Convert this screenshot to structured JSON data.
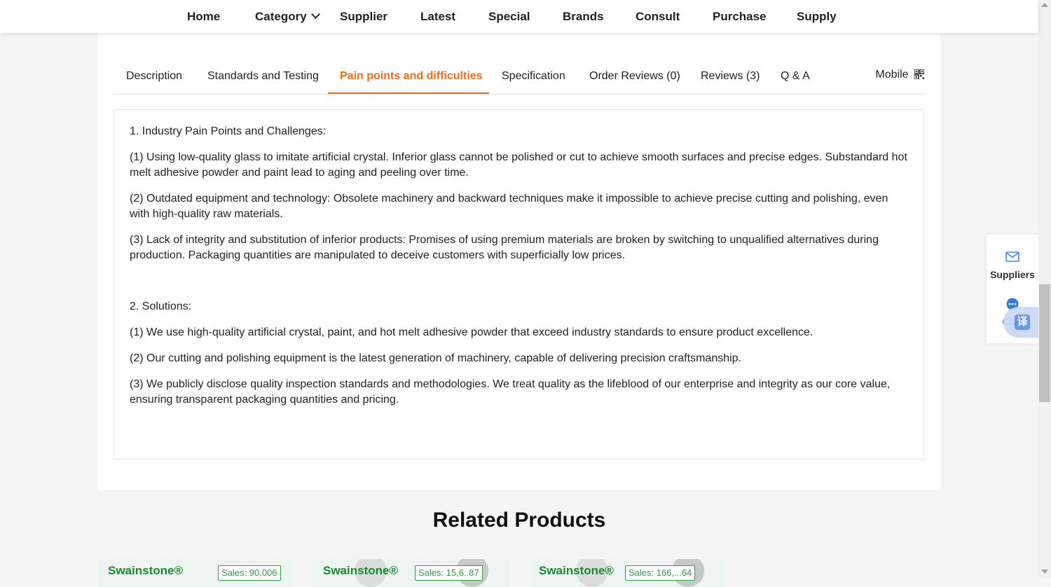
{
  "nav": {
    "home": "Home",
    "category": "Category",
    "supplier": "Supplier",
    "latest": "Latest",
    "special": "Special",
    "brands": "Brands",
    "consult": "Consult",
    "purchase": "Purchase",
    "supply": "Supply"
  },
  "tabs": {
    "description": "Description",
    "standards": "Standards and Testing",
    "pain_points": "Pain points and difficulties",
    "specification": "Specification",
    "order_reviews": "Order Reviews (0)",
    "reviews": "Reviews (3)",
    "qa": "Q & A",
    "mobile": "Mobile",
    "active": "pain_points"
  },
  "content": {
    "heading1": "1. Industry Pain Points and Challenges:",
    "p1": "(1) Using low-quality glass to imitate artificial crystal. Inferior glass cannot be polished or cut to achieve smooth surfaces and precise edges. Substandard hot melt adhesive powder and paint lead to aging and peeling over time.",
    "p2": "(2) Outdated equipment and technology: Obsolete machinery and backward techniques make it impossible to achieve precise cutting and polishing, even with high-quality raw materials.",
    "p3": "(3) Lack of integrity and substitution of inferior products: Promises of using premium materials are broken by switching to unqualified alternatives during production. Packaging quantities are manipulated to deceive customers with superficially low prices.",
    "heading2": "2. Solutions:",
    "s1": "(1) We use high-quality artificial crystal, paint, and hot melt adhesive powder that exceed industry standards to ensure product excellence.",
    "s2": "(2) Our cutting and polishing equipment is the latest generation of machinery, capable of delivering precision craftsmanship.",
    "s3": "(3) We publicly disclose quality inspection standards and methodologies. We treat quality as the lifeblood of our enterprise and integrity as our core value, ensuring transparent packaging quantities and pricing."
  },
  "related": {
    "title": "Related Products",
    "products": [
      {
        "brand": "Swainstone®",
        "sales": "Sales: 90,006"
      },
      {
        "brand": "Swainstone®",
        "sales": "Sales: 15,6..87"
      },
      {
        "brand": "Swainstone®",
        "sales": "Sales: 166,...64"
      }
    ]
  },
  "side": {
    "suppliers": "Suppliers",
    "chat": "Chat",
    "translate": "译"
  },
  "colors": {
    "accent": "#f26b1d",
    "brand_green": "#1a8a2e",
    "icon_blue": "#3a8ee6"
  }
}
